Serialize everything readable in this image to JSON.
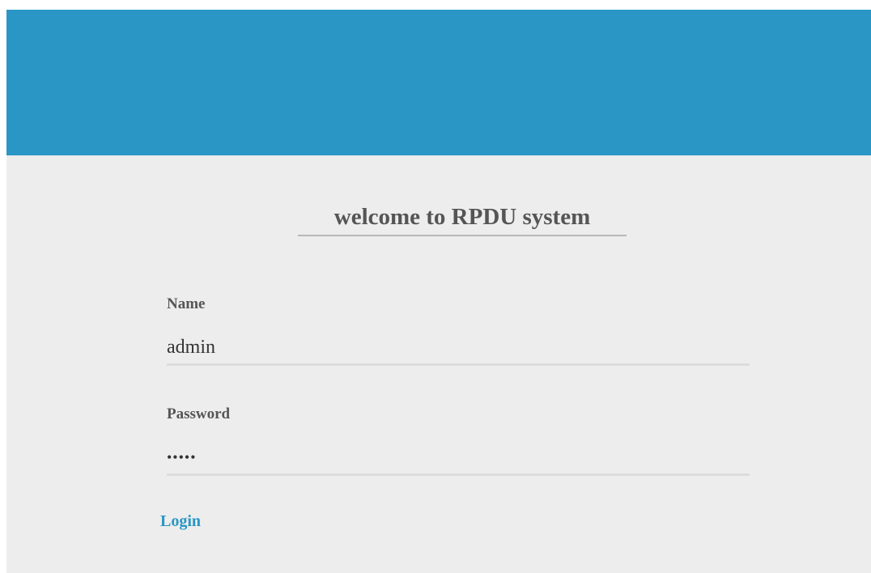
{
  "banner": {
    "color": "#2a96c5"
  },
  "login_form": {
    "title": "welcome to RPDU system",
    "name_label": "Name",
    "name_value": "admin",
    "password_label": "Password",
    "password_value": "•••••",
    "login_label": "Login"
  },
  "colors": {
    "background": "#ededed",
    "accent": "#2a96c5",
    "text": "#555555"
  }
}
